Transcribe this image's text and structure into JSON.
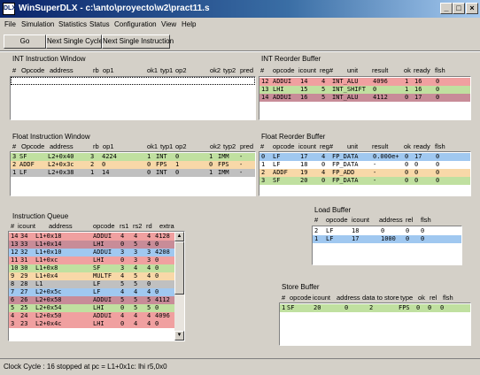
{
  "window": {
    "app_icon": "DLX",
    "title": "WinSuperDLX - c:\\anto\\proyecto\\w2\\pract11.s",
    "minimize": "_",
    "maximize": "□",
    "close": "×"
  },
  "menu": [
    "File",
    "Simulation",
    "Statistics",
    "Status",
    "Configuration",
    "View",
    "Help"
  ],
  "toolbar": {
    "go": "Go",
    "next_cycle": "Next Single Cycle",
    "next_instruction": "Next Single Instruction"
  },
  "colors": {
    "red": "#f0a0a0",
    "green": "#c0e0a0",
    "blue": "#a0c8f0",
    "orange": "#f8d8a8",
    "gray": "#c0c0c0",
    "rose": "#c88c98"
  },
  "int_window": {
    "title": "INT Instruction Window",
    "headers": [
      "#",
      "Opcode",
      "address",
      "rb",
      "op1",
      "ok1",
      "typ1",
      "op2",
      "ok2",
      "typ2",
      "pred"
    ],
    "rows": []
  },
  "int_rob": {
    "title": "INT Reorder Buffer",
    "headers": [
      "#",
      "opcode",
      "icount",
      "reg#",
      "unit",
      "result",
      "ok",
      "ready",
      "flsh"
    ],
    "rows": [
      {
        "cells": [
          "12",
          "ADDUI",
          "14",
          "4",
          "INT_ALU",
          "4096",
          "1",
          "16",
          "0"
        ],
        "color": "red"
      },
      {
        "cells": [
          "13",
          "LHI",
          "15",
          "5",
          "INT_SHIFT",
          "0",
          "1",
          "16",
          "0"
        ],
        "color": "green"
      },
      {
        "cells": [
          "14",
          "ADDUI",
          "16",
          "5",
          "INT_ALU",
          "4112",
          "0",
          "17",
          "0"
        ],
        "color": "rose"
      }
    ]
  },
  "float_window": {
    "title": "Float Instruction Window",
    "headers": [
      "#",
      "Opcode",
      "address",
      "rb",
      "op1",
      "ok1",
      "typ1",
      "op2",
      "ok2",
      "typ2",
      "pred"
    ],
    "rows": [
      {
        "cells": [
          "3",
          "SF",
          "L2+0x40",
          "3",
          "4224",
          "1",
          "INT",
          "0",
          "1",
          "IMM",
          "-"
        ],
        "color": "green"
      },
      {
        "cells": [
          "2",
          "ADDF",
          "L2+0x3c",
          "2",
          "0",
          "0",
          "FPS",
          "1",
          "0",
          "FPS",
          "-"
        ],
        "color": "orange"
      },
      {
        "cells": [
          "1",
          "LF",
          "L2+0x38",
          "1",
          "14",
          "0",
          "INT",
          "0",
          "1",
          "IMM",
          "-"
        ],
        "color": "gray"
      }
    ]
  },
  "float_rob": {
    "title": "Float Reorder Buffer",
    "headers": [
      "#",
      "opcode",
      "icount",
      "reg#",
      "unit",
      "result",
      "ok",
      "ready",
      "flsh"
    ],
    "rows": [
      {
        "cells": [
          "0",
          "LF",
          "17",
          "4",
          "FP_DATA",
          "0.000e+",
          "0",
          "17",
          "0"
        ],
        "color": "blue"
      },
      {
        "cells": [
          "1",
          "LF",
          "18",
          "0",
          "FP_DATA",
          "-",
          "0",
          "0",
          "0"
        ],
        "color": "white"
      },
      {
        "cells": [
          "2",
          "ADDF",
          "19",
          "4",
          "FP_ADD",
          "-",
          "0",
          "0",
          "0"
        ],
        "color": "orange"
      },
      {
        "cells": [
          "3",
          "SF",
          "20",
          "0",
          "FP_DATA",
          "-",
          "0",
          "0",
          "0"
        ],
        "color": "green"
      }
    ]
  },
  "iq": {
    "title": "Instruction Queue",
    "headers": [
      "#",
      "icount",
      "address",
      "opcode",
      "rs1",
      "rs2",
      "rd",
      "extra"
    ],
    "rows": [
      {
        "cells": [
          "14",
          "34",
          "L1+0x18",
          "ADDUI",
          "4",
          "4",
          "4",
          "4128"
        ],
        "color": "red"
      },
      {
        "cells": [
          "13",
          "33",
          "L1+0x14",
          "LHI",
          "0",
          "5",
          "4",
          "0"
        ],
        "color": "rose"
      },
      {
        "cells": [
          "12",
          "32",
          "L1+0x10",
          "ADDUI",
          "3",
          "3",
          "3",
          "4208"
        ],
        "color": "blue"
      },
      {
        "cells": [
          "11",
          "31",
          "L1+0xc",
          "LHI",
          "0",
          "3",
          "3",
          "0"
        ],
        "color": "red"
      },
      {
        "cells": [
          "10",
          "30",
          "L1+0x8",
          "SF",
          "3",
          "4",
          "4",
          "0"
        ],
        "color": "green"
      },
      {
        "cells": [
          "9",
          "29",
          "L1+0x4",
          "MULTF",
          "4",
          "5",
          "4",
          "0"
        ],
        "color": "orange"
      },
      {
        "cells": [
          "8",
          "28",
          "L1",
          "LF",
          "5",
          "5",
          "0",
          ""
        ],
        "color": "gray"
      },
      {
        "cells": [
          "7",
          "27",
          "L2+0x5c",
          "LF",
          "4",
          "4",
          "4",
          "0"
        ],
        "color": "blue"
      },
      {
        "cells": [
          "6",
          "26",
          "L2+0x58",
          "ADDUI",
          "5",
          "5",
          "5",
          "4112"
        ],
        "color": "rose"
      },
      {
        "cells": [
          "5",
          "25",
          "L2+0x54",
          "LHI",
          "0",
          "5",
          "5",
          "0"
        ],
        "color": "green"
      },
      {
        "cells": [
          "4",
          "24",
          "L2+0x50",
          "ADDUI",
          "4",
          "4",
          "4",
          "4096"
        ],
        "color": "red"
      },
      {
        "cells": [
          "3",
          "23",
          "L2+0x4c",
          "LHI",
          "0",
          "4",
          "4",
          "0"
        ],
        "color": "red"
      }
    ]
  },
  "load_buffer": {
    "title": "Load Buffer",
    "headers": [
      "#",
      "opcode",
      "icount",
      "address",
      "rel",
      "flsh"
    ],
    "rows": [
      {
        "cells": [
          "2",
          "LF",
          "18",
          "0",
          "0",
          "0"
        ],
        "color": "white"
      },
      {
        "cells": [
          "1",
          "LF",
          "17",
          "1000",
          "0",
          "0"
        ],
        "color": "blue"
      }
    ]
  },
  "store_buffer": {
    "title": "Store Buffer",
    "headers": [
      "#",
      "opcode",
      "icount",
      "address",
      "data to store",
      "type",
      "ok",
      "rel",
      "flsh"
    ],
    "rows": [
      {
        "cells": [
          "1",
          "SF",
          "20",
          "0",
          "2",
          "FPS",
          "0",
          "0",
          "0"
        ],
        "color": "green"
      }
    ]
  },
  "status": {
    "cycle": "Clock Cycle : 16",
    "message": "stopped at pc = L1+0x1c: lhi r5,0x0"
  }
}
